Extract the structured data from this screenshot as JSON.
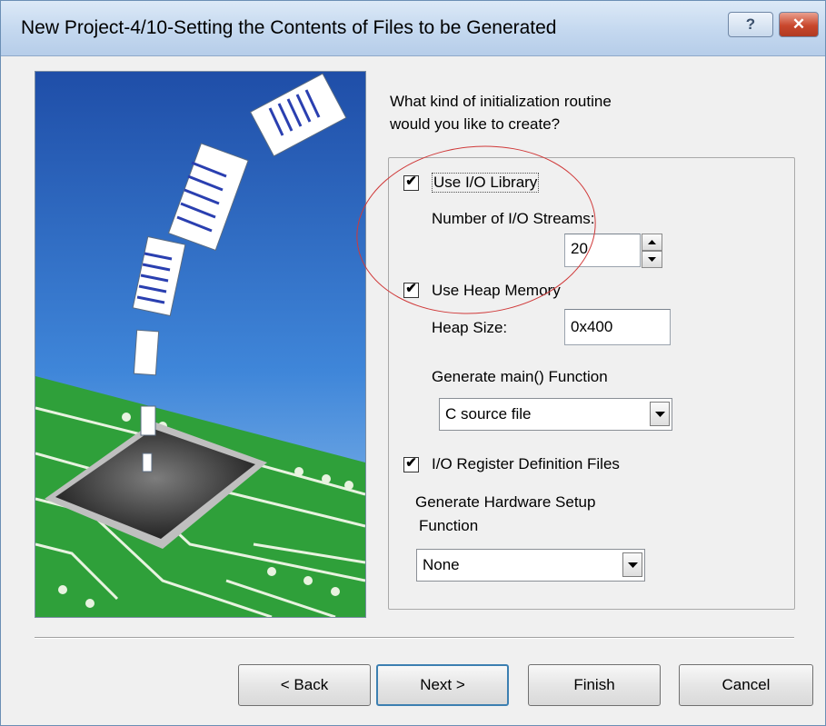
{
  "window": {
    "title": "New Project-4/10-Setting the Contents of Files to be Generated",
    "help_label": "?",
    "close_label": "✕"
  },
  "prompt": {
    "line1": "What kind of initialization routine",
    "line2": "would you like to create?"
  },
  "options": {
    "use_io_library": {
      "label": "Use I/O Library",
      "checked": true
    },
    "io_streams": {
      "label": "Number of I/O Streams:",
      "value": "20"
    },
    "use_heap_memory": {
      "label": "Use Heap Memory",
      "checked": true
    },
    "heap_size": {
      "label": "Heap Size:",
      "value": "0x400"
    },
    "generate_main": {
      "label": "Generate main() Function",
      "selected": "C source file"
    },
    "io_register": {
      "label": "I/O Register Definition Files",
      "checked": true
    },
    "hardware_setup": {
      "label_line1": "Generate Hardware Setup",
      "label_line2": "Function",
      "selected": "None"
    }
  },
  "buttons": {
    "back": "< Back",
    "next": "Next >",
    "finish": "Finish",
    "cancel": "Cancel"
  },
  "checkmark": "✔",
  "colors": {
    "annotation": "#d03a3a",
    "sky_top": "#1f4ea8",
    "board": "#2fa03a"
  }
}
